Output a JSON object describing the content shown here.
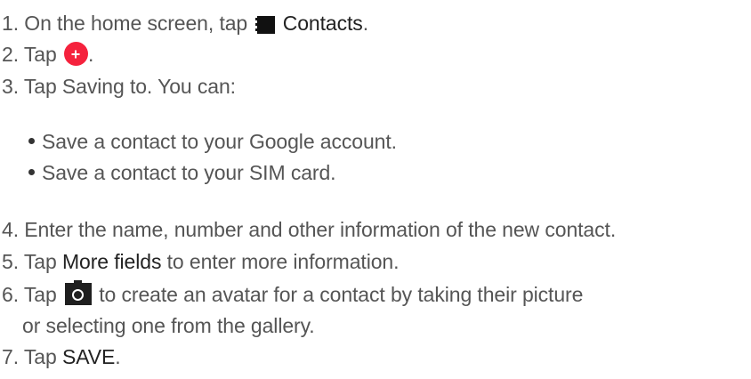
{
  "steps": [
    {
      "number": "1.",
      "text_before": "On the home screen, tap",
      "icon": "contacts-app-icon",
      "bold": "Contacts",
      "text_after": "."
    },
    {
      "number": "2.",
      "text_before": "Tap",
      "icon": "add-contact-icon",
      "text_after": "."
    },
    {
      "number": "3.",
      "text": "Tap Saving to. You can:"
    },
    {
      "number": "4.",
      "text": "Enter the name, number and other information of the new contact."
    },
    {
      "number": "5.",
      "text_before": "Tap",
      "bold": "More fields",
      "text_after": "to enter more information."
    },
    {
      "number": "6.",
      "text_before": "Tap",
      "icon": "camera-icon",
      "text_after": "to create an avatar for a contact by taking their picture",
      "text_continued": "or selecting one from the gallery."
    },
    {
      "number": "7.",
      "text_before": "Tap",
      "bold": "SAVE",
      "text_after": "."
    }
  ],
  "options": [
    "Save a contact to your Google account.",
    "Save a contact to your SIM card."
  ],
  "colors": {
    "text": "#555555",
    "emphasis": "#222222",
    "add_button": "#f5223d",
    "icon_dark": "#1f1f1f"
  }
}
